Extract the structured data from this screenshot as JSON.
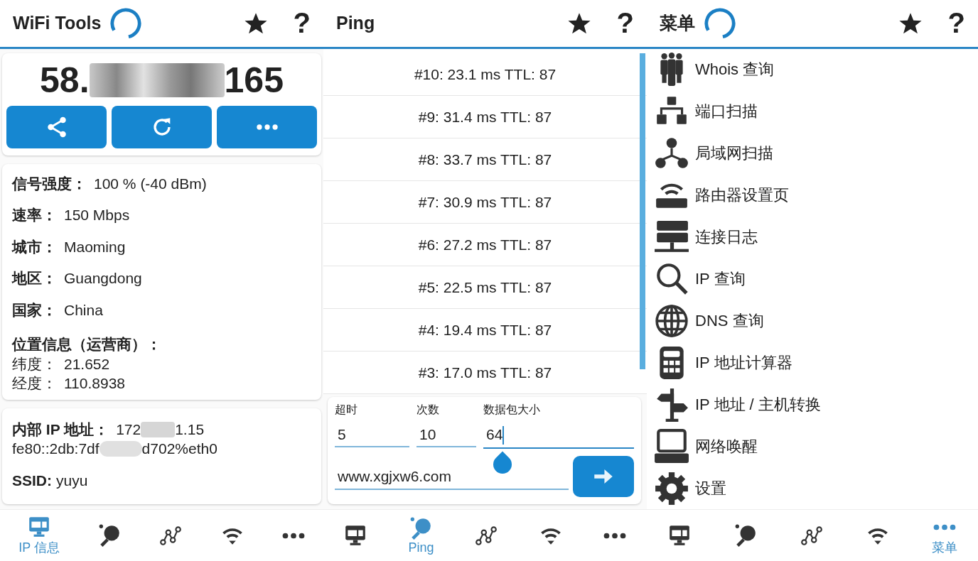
{
  "ip_panel": {
    "header": {
      "title": "WiFi Tools",
      "loading": true,
      "help": "?"
    },
    "public_ip": {
      "prefix": "58.",
      "suffix": "165"
    },
    "actions": [
      {
        "kind": "share"
      },
      {
        "kind": "refresh"
      },
      {
        "kind": "more"
      }
    ],
    "details": [
      {
        "label": "信号强度：",
        "value": "100 % (-40 dBm)"
      },
      {
        "label": "速率：",
        "value": "150 Mbps"
      },
      {
        "label": "城市：",
        "value": "Maoming"
      },
      {
        "label": "地区：",
        "value": "Guangdong"
      },
      {
        "label": "国家：",
        "value": "China"
      }
    ],
    "location": {
      "heading": "位置信息（运营商）：",
      "rows": [
        {
          "label": "纬度：",
          "value": "21.652"
        },
        {
          "label": "经度：",
          "value": "110.8938"
        }
      ]
    },
    "network": {
      "internal_ip_label": "内部 IP 地址：",
      "internal_ip_prefix": "172",
      "internal_ip_suffix": "1.15",
      "ipv6_prefix": "fe80::2db:7df",
      "ipv6_suffix": "d702%eth0",
      "ssid_label": "SSID:",
      "ssid": "yuyu"
    },
    "nav": [
      {
        "kind": "ip",
        "label": "IP 信息",
        "selected": true
      },
      {
        "kind": "ping",
        "selected": false
      },
      {
        "kind": "graph",
        "selected": false
      },
      {
        "kind": "wifi",
        "selected": false
      },
      {
        "kind": "more",
        "selected": false
      }
    ]
  },
  "ping_panel": {
    "header": {
      "title": "Ping",
      "loading": false,
      "help": "?"
    },
    "results": [
      "#10: 23.1 ms TTL: 87",
      "#9: 31.4 ms TTL: 87",
      "#8: 33.7 ms TTL: 87",
      "#7: 30.9 ms TTL: 87",
      "#6: 27.2 ms TTL: 87",
      "#5: 22.5 ms TTL: 87",
      "#4: 19.4 ms TTL: 87",
      "#3: 17.0 ms TTL: 87"
    ],
    "fields": [
      {
        "label": "超时",
        "value": "5",
        "focused": false
      },
      {
        "label": "次数",
        "value": "10",
        "focused": false
      },
      {
        "label": "数据包大小",
        "value": "64",
        "focused": true
      }
    ],
    "host": "www.xgjxw6.com",
    "nav": [
      {
        "kind": "ip",
        "selected": false
      },
      {
        "kind": "ping",
        "label": "Ping",
        "selected": true
      },
      {
        "kind": "graph",
        "selected": false
      },
      {
        "kind": "wifi",
        "selected": false
      },
      {
        "kind": "more",
        "selected": false
      }
    ]
  },
  "menu_panel": {
    "header": {
      "title": "菜单",
      "loading": true,
      "help": "?"
    },
    "items": [
      {
        "kind": "people",
        "label": "Whois 查询"
      },
      {
        "kind": "hierarchy",
        "label": "端口扫描"
      },
      {
        "kind": "lan",
        "label": "局域网扫描"
      },
      {
        "kind": "router",
        "label": "路由器设置页"
      },
      {
        "kind": "server",
        "label": "连接日志"
      },
      {
        "kind": "search",
        "label": "IP 查询"
      },
      {
        "kind": "globe",
        "label": "DNS 查询"
      },
      {
        "kind": "calculator",
        "label": "IP 地址计算器"
      },
      {
        "kind": "signpost",
        "label": "IP 地址 / 主机转换"
      },
      {
        "kind": "computer",
        "label": "网络唤醒"
      },
      {
        "kind": "gear",
        "label": "设置"
      }
    ],
    "nav": [
      {
        "kind": "ip",
        "selected": false
      },
      {
        "kind": "ping",
        "selected": false
      },
      {
        "kind": "graph",
        "selected": false
      },
      {
        "kind": "wifi",
        "selected": false
      },
      {
        "kind": "more",
        "label": "菜单",
        "selected": true
      }
    ]
  }
}
